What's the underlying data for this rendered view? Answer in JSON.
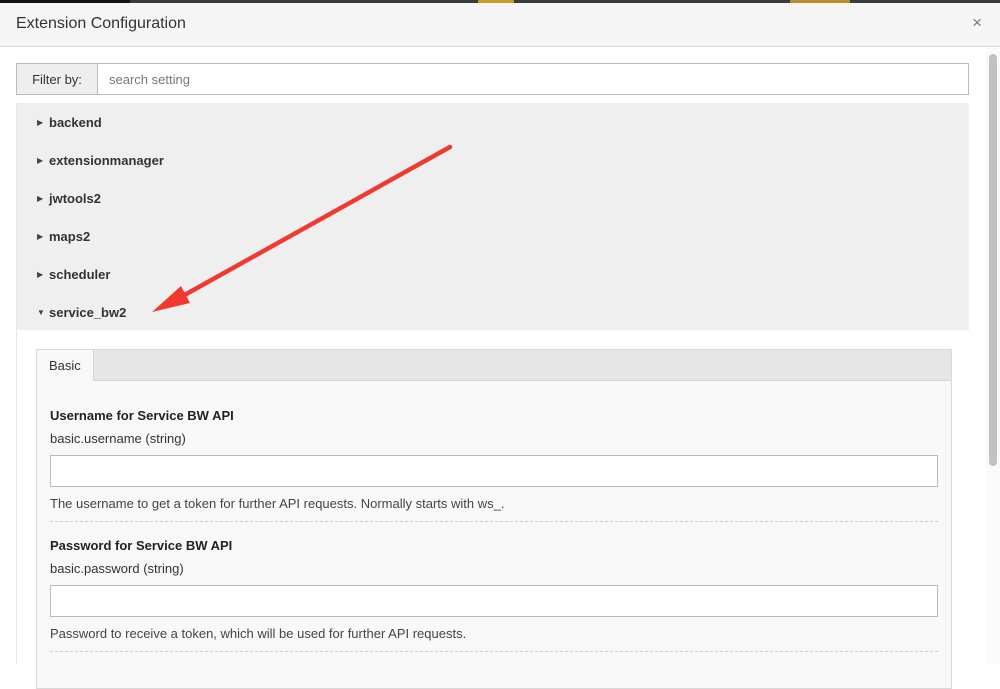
{
  "modal": {
    "title": "Extension Configuration",
    "close_icon_glyph": "×"
  },
  "filter": {
    "label": "Filter by:",
    "placeholder": "search setting",
    "value": ""
  },
  "extensions": [
    {
      "label": "backend",
      "expanded": false
    },
    {
      "label": "extensionmanager",
      "expanded": false
    },
    {
      "label": "jwtools2",
      "expanded": false
    },
    {
      "label": "maps2",
      "expanded": false
    },
    {
      "label": "scheduler",
      "expanded": false
    },
    {
      "label": "service_bw2",
      "expanded": true
    }
  ],
  "tabs": [
    {
      "label": "Basic",
      "active": true
    }
  ],
  "settings": [
    {
      "title": "Username for Service BW API",
      "key": "basic.username (string)",
      "value": "",
      "description": "The username to get a token for further API requests. Normally starts with ws_."
    },
    {
      "title": "Password for Service BW API",
      "key": "basic.password (string)",
      "value": "",
      "description": "Password to receive a token, which will be used for further API requests."
    }
  ],
  "colors": {
    "annotation_arrow": "#ee3a2f",
    "header_bg": "#f5f5f5",
    "list_bg": "#efefef"
  }
}
